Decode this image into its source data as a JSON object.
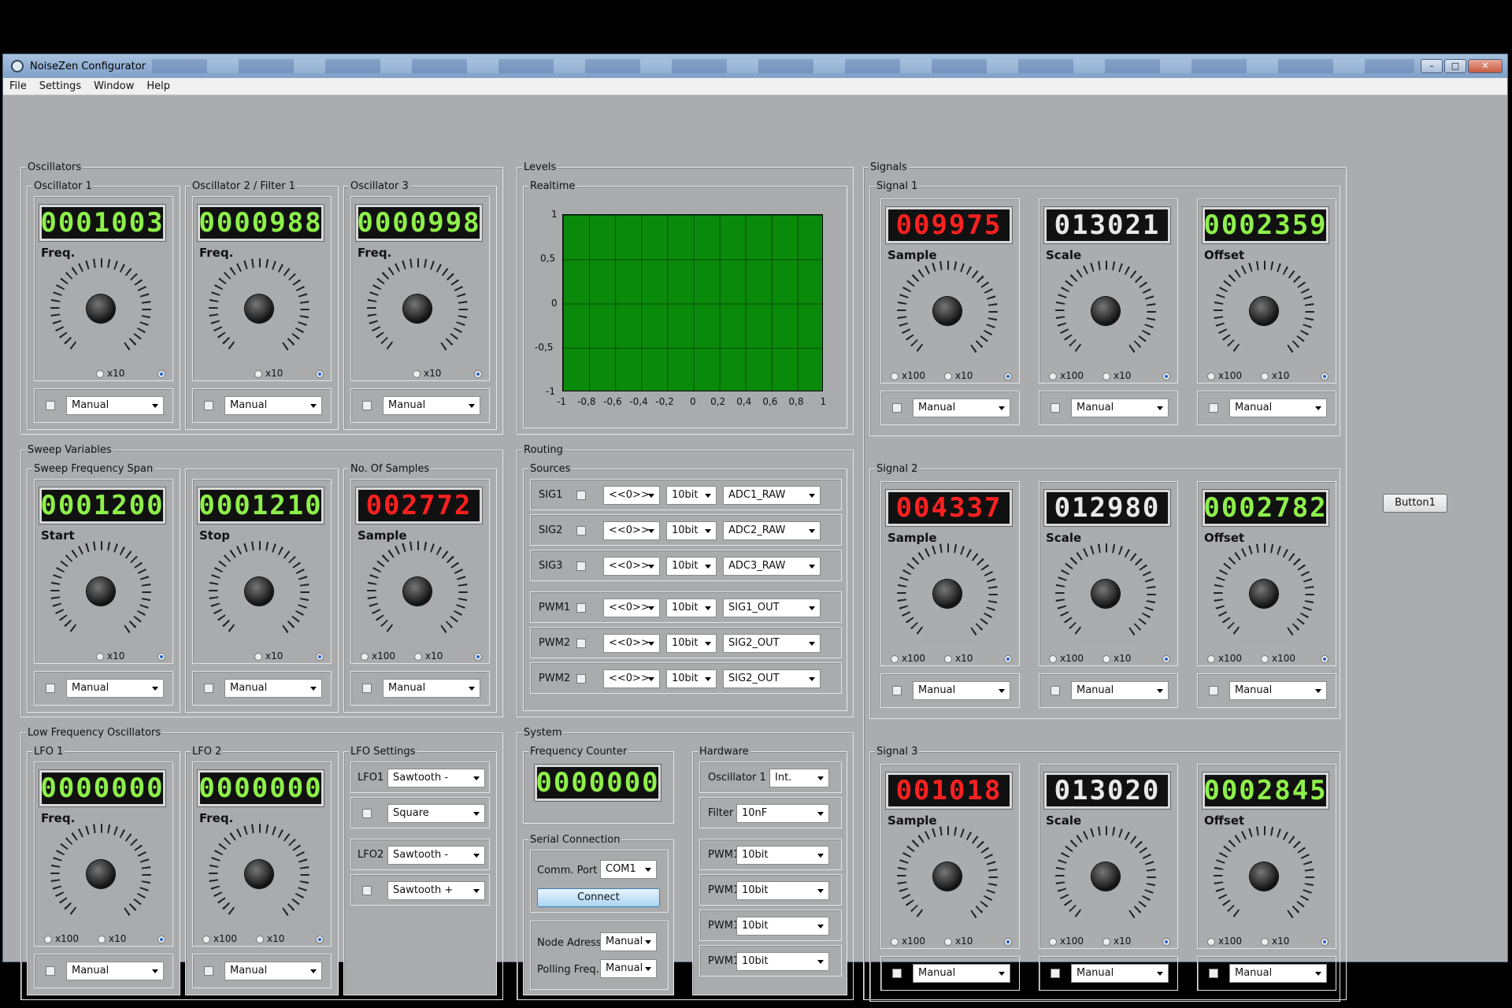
{
  "window": {
    "title": "NoiseZen Configurator"
  },
  "menu": [
    "File",
    "Settings",
    "Window",
    "Help"
  ],
  "common": {
    "manual": "Manual",
    "x10": "x10",
    "x100": "x100",
    "freq": "Freq.",
    "sample": "Sample",
    "scale": "Scale",
    "offset": "Offset"
  },
  "groups": {
    "oscillators": "Oscillators",
    "sweep": "Sweep Variables",
    "lfos": "Low Frequency Oscillators",
    "levels": "Levels",
    "routing": "Routing",
    "system": "System",
    "signals": "Signals"
  },
  "oscillators": [
    {
      "title": "Oscillator 1",
      "value": "0001003"
    },
    {
      "title": "Oscillator 2 / Filter 1",
      "value": "0000988"
    },
    {
      "title": "Oscillator 3",
      "value": "0000998"
    }
  ],
  "sweep": [
    {
      "title": "Sweep Frequency Span",
      "label": "Start",
      "value": "0001200"
    },
    {
      "title": "",
      "label": "Stop",
      "value": "0001210"
    },
    {
      "title": "No. Of Samples",
      "label": "Sample",
      "value": "002772"
    }
  ],
  "lfos": [
    {
      "title": "LFO 1",
      "value": "0000000"
    },
    {
      "title": "LFO 2",
      "value": "0000000"
    }
  ],
  "lfo_settings": {
    "title": "LFO Settings",
    "rows": [
      {
        "label": "LFO1",
        "value": "Sawtooth -"
      },
      {
        "label": "",
        "value": "Square"
      },
      {
        "label": "LFO2",
        "value": "Sawtooth -"
      },
      {
        "label": "",
        "value": "Sawtooth +"
      }
    ]
  },
  "levels": {
    "realtime": "Realtime",
    "chart_data": {
      "type": "line",
      "title": "",
      "xlim": [
        -1,
        1
      ],
      "ylim": [
        -1,
        1
      ],
      "xticks": [
        "-1",
        "-0,8",
        "-0,6",
        "-0,4",
        "-0,2",
        "0",
        "0,2",
        "0,4",
        "0,6",
        "0,8",
        "1"
      ],
      "yticks": [
        "1",
        "0,5",
        "0",
        "-0,5",
        "-1"
      ],
      "series": [],
      "grid": true,
      "background": "#0a8a0a"
    }
  },
  "routing": {
    "sources_title": "Sources",
    "rows": [
      {
        "label": "SIG1",
        "a": "<<0>>",
        "b": "10bit",
        "c": "ADC1_RAW"
      },
      {
        "label": "SIG2",
        "a": "<<0>>",
        "b": "10bit",
        "c": "ADC2_RAW"
      },
      {
        "label": "SIG3",
        "a": "<<0>>",
        "b": "10bit",
        "c": "ADC3_RAW"
      },
      {
        "label": "PWM1",
        "a": "<<0>>",
        "b": "10bit",
        "c": "SIG1_OUT"
      },
      {
        "label": "PWM2",
        "a": "<<0>>",
        "b": "10bit",
        "c": "SIG2_OUT"
      },
      {
        "label": "PWM2",
        "a": "<<0>>",
        "b": "10bit",
        "c": "SIG2_OUT"
      }
    ]
  },
  "system": {
    "freq_counter": {
      "title": "Frequency Counter",
      "value": "0000000"
    },
    "serial": {
      "title": "Serial Connection",
      "comm_label": "Comm. Port",
      "comm_value": "COM1",
      "connect": "Connect",
      "node_label": "Node Adress.",
      "node_value": "Manual",
      "poll_label": "Polling Freq.",
      "poll_value": "Manual"
    },
    "hardware": {
      "title": "Hardware",
      "rows": [
        {
          "label": "Oscillator 1",
          "value": "Int."
        },
        {
          "label": "Filter",
          "value": "10nF"
        },
        {
          "label": "PWM1",
          "value": "10bit"
        },
        {
          "label": "PWM1",
          "value": "10bit"
        },
        {
          "label": "PWM1",
          "value": "10bit"
        },
        {
          "label": "PWM1",
          "value": "10bit"
        }
      ]
    }
  },
  "signals": [
    {
      "title": "Signal 1",
      "sample": "009975",
      "scale": "013021",
      "offset": "0002359",
      "radio_labels": [
        [
          "x100",
          "x10"
        ],
        [
          "x100",
          "x10"
        ],
        [
          "x100",
          "x10"
        ]
      ]
    },
    {
      "title": "Signal 2",
      "sample": "004337",
      "scale": "012980",
      "offset": "0002782",
      "radio_labels": [
        [
          "x100",
          "x10"
        ],
        [
          "x100",
          "x10"
        ],
        [
          "x100",
          "x100"
        ]
      ]
    },
    {
      "title": "Signal 3",
      "sample": "001018",
      "scale": "013020",
      "offset": "0002845",
      "radio_labels": [
        [
          "x100",
          "x10"
        ],
        [
          "x100",
          "x10"
        ],
        [
          "x100",
          "x10"
        ]
      ]
    }
  ],
  "button1": "Button1"
}
